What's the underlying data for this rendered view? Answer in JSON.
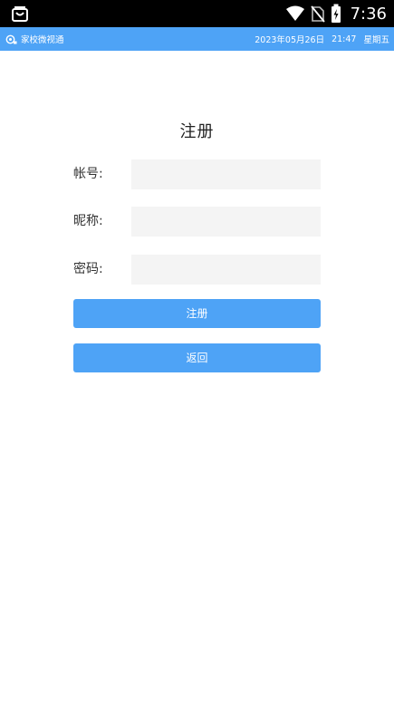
{
  "status_bar": {
    "time": "7:36",
    "icons": [
      "shopping-bag-icon",
      "wifi-icon",
      "no-sim-icon",
      "battery-charging-icon"
    ]
  },
  "app_header": {
    "app_name": "家校微视通",
    "date": "2023年05月26日",
    "time": "21:47",
    "weekday": "星期五",
    "logo_icon": "camera-logo-icon"
  },
  "form": {
    "title": "注册",
    "fields": [
      {
        "label": "帐号:",
        "value": ""
      },
      {
        "label": "昵称:",
        "value": ""
      },
      {
        "label": "密码:",
        "value": ""
      }
    ],
    "register_label": "注册",
    "back_label": "返回"
  },
  "colors": {
    "accent": "#4ea3f6",
    "status_bar": "#000000",
    "input_bg": "#f4f4f4",
    "background": "#ffffff"
  }
}
